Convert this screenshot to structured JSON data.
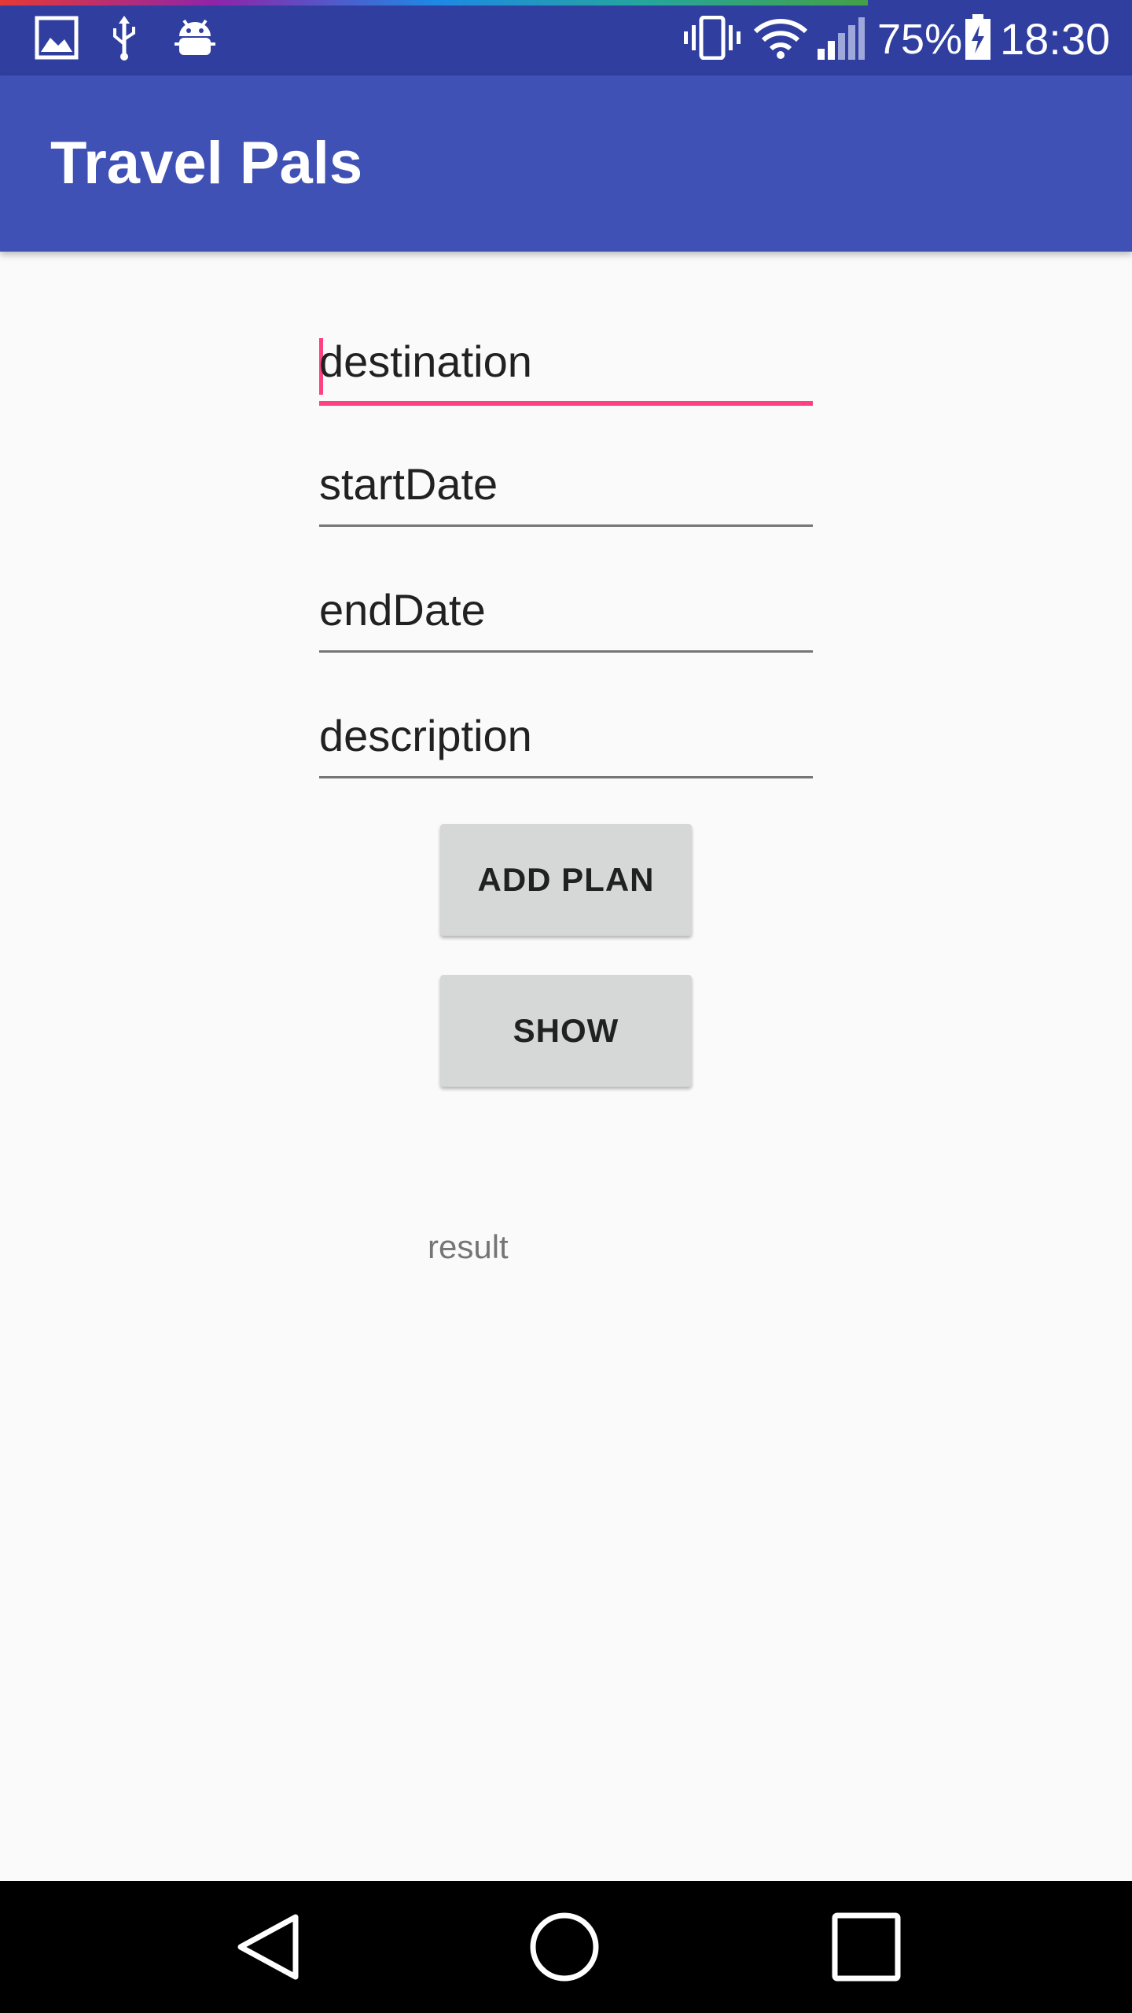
{
  "status_bar": {
    "battery_percent": "75%",
    "time": "18:30",
    "icons": [
      "gallery-icon",
      "usb-icon",
      "android-debug-icon",
      "vibrate-icon",
      "wifi-icon",
      "signal-icon",
      "battery-charging-icon"
    ]
  },
  "app_bar": {
    "title": "Travel Pals"
  },
  "form": {
    "destination": "destination",
    "start_date": "startDate",
    "end_date": "endDate",
    "description": "description"
  },
  "buttons": {
    "add_plan": "ADD PLAN",
    "show": "SHOW"
  },
  "result": "result",
  "nav_bar": {
    "icons": [
      "back-icon",
      "home-icon",
      "recents-icon"
    ]
  },
  "colors": {
    "status_bar": "#303f9f",
    "app_bar": "#3f51b5",
    "accent": "#ff4081",
    "background": "#fafafa",
    "button": "#d6d7d7"
  }
}
